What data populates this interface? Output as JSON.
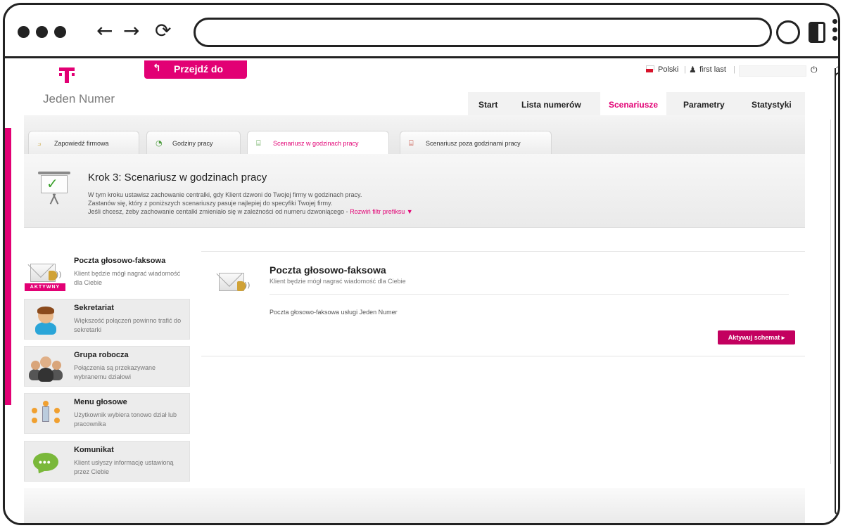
{
  "browser": {
    "url": "",
    "back_icon": "←",
    "forward_icon": "→",
    "reload_icon": "⟳"
  },
  "header": {
    "logo_text": "Jeden Numer",
    "goto_label": "Przejdź do",
    "goto_arrow": "↰",
    "language": "Polski",
    "user": "first last",
    "user_icon": "♟",
    "separator": "|",
    "power_icon": "⏻"
  },
  "main_nav": {
    "tabs": [
      {
        "label": "Start",
        "active": false
      },
      {
        "label": "Lista numerów",
        "active": false
      },
      {
        "label": "Scenariusze",
        "active": true
      },
      {
        "label": "Parametry",
        "active": false
      },
      {
        "label": "Statystyki",
        "active": false
      }
    ]
  },
  "sub_tabs": [
    {
      "label": "Zapowiedź firmowa",
      "icon": "⟓",
      "active": false
    },
    {
      "label": "Godziny pracy",
      "icon": "◔",
      "active": false
    },
    {
      "label": "Scenariusz w godzinach pracy",
      "icon": "⌸",
      "active": true
    },
    {
      "label": "Scenariusz poza godzinami pracy",
      "icon": "⌸",
      "active": false
    }
  ],
  "step": {
    "title": "Krok 3: Scenariusz w godzinach pracy",
    "line1": "W tym kroku ustawisz zachowanie centralki, gdy Klient dzwoni do Twojej firmy w godzinach pracy.",
    "line2": "Zastanów się, który z poniższych scenariuszy pasuje najlepiej do specyfiki Twojej firmy.",
    "line3": "Jeśli chcesz, żeby zachowanie centalki zmieniało się w zależności od numeru dzwoniącego - ",
    "link": "Rozwiń filtr prefiksu ▼"
  },
  "scenarios": [
    {
      "title": "Poczta głosowo-faksowa",
      "desc": "Klient będzie mógł nagrać wiadomość dla Ciebie",
      "badge": "AKTYWNY",
      "active": true
    },
    {
      "title": "Sekretariat",
      "desc": "Większość połączeń powinno trafić do sekretarki",
      "active": false
    },
    {
      "title": "Grupa robocza",
      "desc": "Połączenia są przekazywane wybranemu działowi",
      "active": false
    },
    {
      "title": "Menu głosowe",
      "desc": "Użytkownik wybiera tonowo dział lub pracownika",
      "active": false
    },
    {
      "title": "Komunikat",
      "desc": "Klient usłyszy informację ustawioną przez Ciebie",
      "active": false
    }
  ],
  "detail": {
    "title": "Poczta głosowo-faksowa",
    "subtitle": "Klient będzie mógł nagrać wiadomość dla Ciebie",
    "description": "Poczta głosowo-faksowa usługi Jeden Numer",
    "button": "Aktywuj schemat ▸"
  },
  "colors": {
    "brand": "#e20074",
    "button": "#c3005f"
  }
}
